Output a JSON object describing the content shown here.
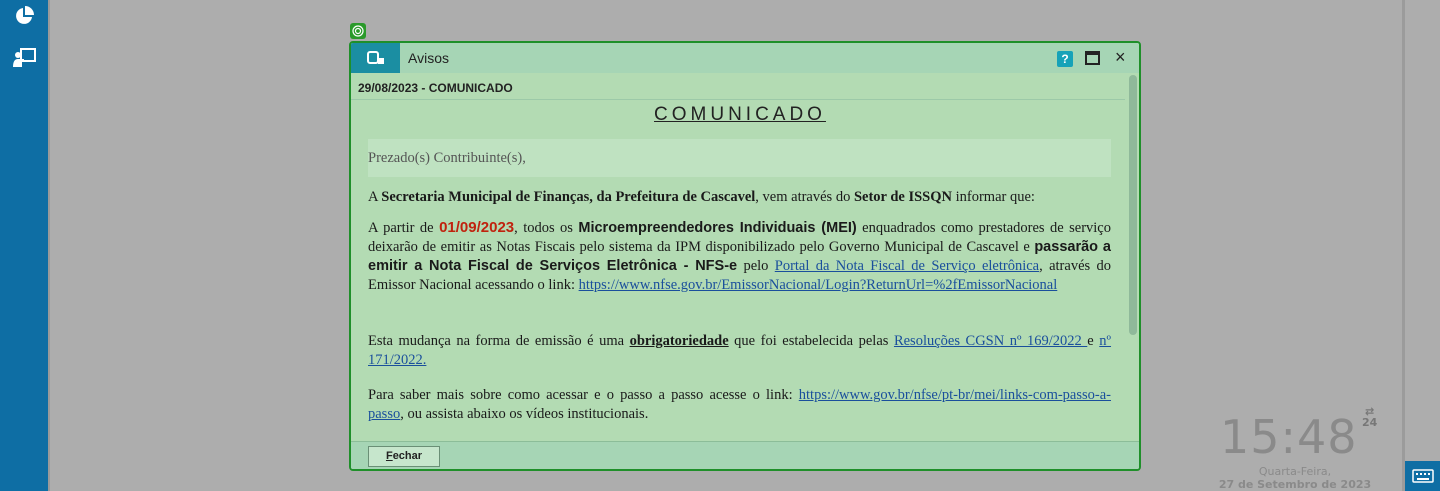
{
  "window": {
    "title": "Avisos",
    "help_label": "?",
    "close_label": "×",
    "subject": "29/08/2023 - COMUNICADO",
    "footer_button_first": "F",
    "footer_button_rest": "echar"
  },
  "message": {
    "heading": "COMUNICADO",
    "greeting": "Prezado(s) Contribuinte(s),",
    "p1": {
      "a": "A ",
      "b": "Secretaria Municipal de  Finanças, da Prefeitura de Cascavel",
      "c": ", vem através do ",
      "d": "Setor de ISSQN",
      "e": " informar que:"
    },
    "p2": {
      "a": "A partir de ",
      "date": "01/09/2023",
      "b": ", todos os ",
      "mei": "Microempreendedores Individuais (MEI)",
      "c": " enquadrados como prestadores de serviço deixarão de emitir as Notas Fiscais pelo sistema da IPM disponibilizado pelo Governo Municipal de Cascavel e ",
      "d": "passarão a emitir a Nota Fiscal de Serviços Eletrônica - NFS-e",
      "e": "  pelo ",
      "link1": "Portal da Nota Fiscal de Serviço eletrônica",
      "f": ", através do Emissor Nacional acessando o link: ",
      "link2": "https://www.nfse.gov.br/EmissorNacional/Login?ReturnUrl=%2fEmissorNacional"
    },
    "p3": {
      "a": "Esta mudança na forma de emissão é uma ",
      "b": "obrigatoriedade",
      "c": " que foi estabelecida pelas ",
      "link1": "Resoluções CGSN nº 169/2022 ",
      "d": "e ",
      "link2": "nº 171/2022."
    },
    "p4": {
      "a": "Para saber mais sobre como acessar e o passo a passo acesse o link: ",
      "link": "https://www.gov.br/nfse/pt-br/mei/links-com-passo-a-passo",
      "b": ", ou assista  abaixo os vídeos institucionais."
    }
  },
  "clock": {
    "time": "15:48",
    "mode": "24",
    "weekday": "Quarta-Feira,",
    "date": "27 de Setembro de 2023"
  },
  "colors": {
    "sidebar": "#0e6ea4",
    "window_bg": "#b3dbb3",
    "window_border": "#1f8f2a",
    "accent": "#1b8ea2",
    "date_red": "#c0220e"
  },
  "icons": [
    "pie-chart-icon",
    "user-presentation-icon",
    "window-app-icon",
    "maximize-icon",
    "keyboard-icon",
    "swap-arrows-icon",
    "target-handle-icon"
  ]
}
